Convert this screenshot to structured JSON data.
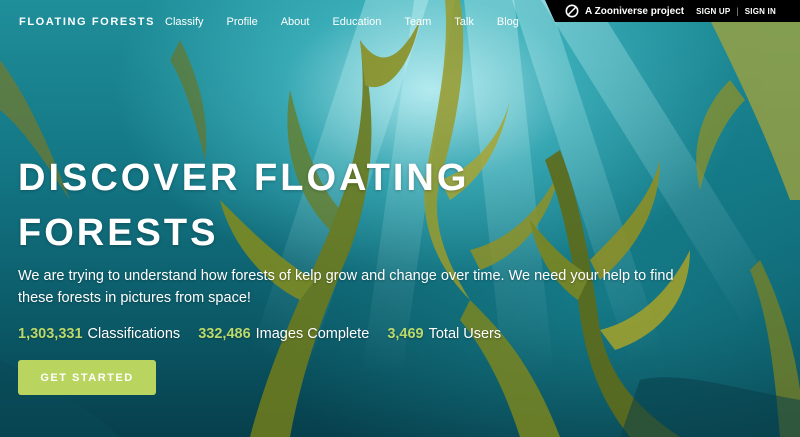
{
  "brand": "FLOATING FORESTS",
  "nav": {
    "items": [
      {
        "label": "Classify"
      },
      {
        "label": "Profile"
      },
      {
        "label": "About"
      },
      {
        "label": "Education"
      },
      {
        "label": "Team"
      },
      {
        "label": "Talk"
      },
      {
        "label": "Blog"
      }
    ]
  },
  "zooniverse": {
    "logo_icon": "zooniverse-logo-icon",
    "project_label": "A Zooniverse project",
    "sign_up": "SIGN UP",
    "separator": "|",
    "sign_in": "SIGN IN"
  },
  "hero": {
    "title": "DISCOVER FLOATING FORESTS",
    "description": "We are trying to understand how forests of kelp grow and change over time. We need your help to find these forests in pictures from space!",
    "stats": [
      {
        "value": "1,303,331",
        "label": "Classifications"
      },
      {
        "value": "332,486",
        "label": "Images Complete"
      },
      {
        "value": "3,469",
        "label": "Total Users"
      }
    ],
    "cta_label": "GET STARTED"
  },
  "colors": {
    "accent_green": "#b9d560",
    "stat_green": "#b9d96a",
    "water_teal": "#137583",
    "zoo_bar": "#000000"
  }
}
